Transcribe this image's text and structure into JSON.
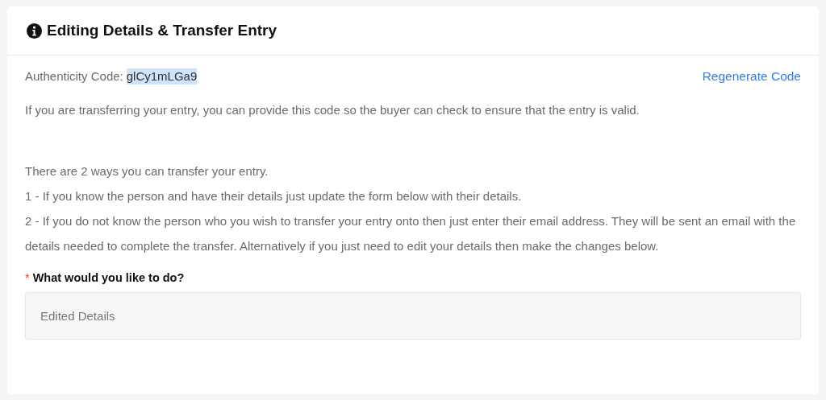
{
  "card": {
    "title": "Editing Details & Transfer Entry",
    "code": {
      "label": "Authenticity Code:",
      "value": "glCy1mLGa9",
      "highlighted": true
    },
    "regenerate_link": "Regenerate Code",
    "intro": "If you are transferring your entry, you can provide this code so the buyer can check to ensure that the entry is valid.",
    "instructions": [
      "There are 2 ways you can transfer your entry.",
      "1 - If you know the person and have their details just update the form below with their details.",
      "2 - If you do not know the person who you wish to transfer your entry onto then just enter their email address. They will be sent an email with the details needed to complete the transfer. Alternatively if you just need to edit your details then make the changes below."
    ],
    "question": {
      "required_mark": "*",
      "label": "What would you like to do?",
      "value": "Edited Details",
      "disabled": true
    }
  }
}
